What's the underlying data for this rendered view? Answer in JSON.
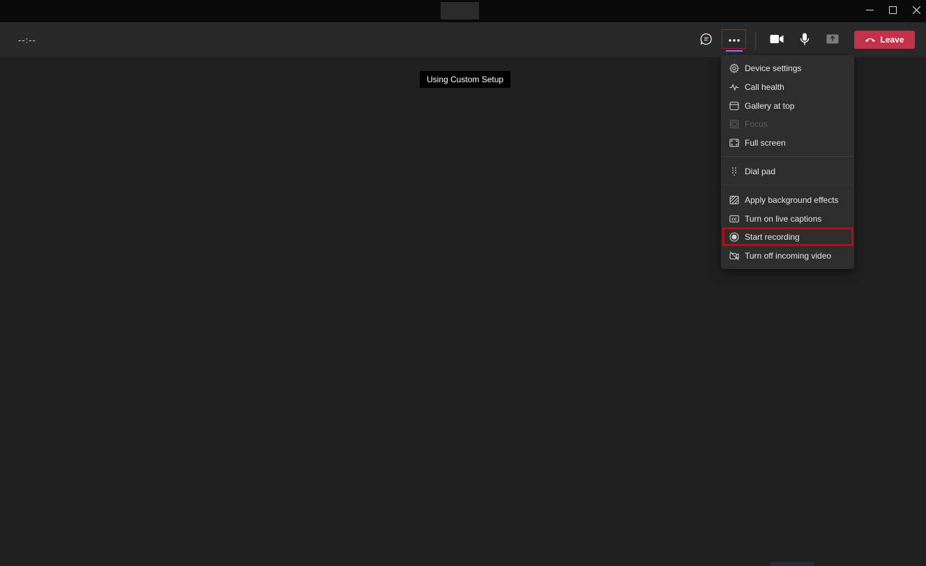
{
  "titlebar": {
    "controls": {
      "minimize_icon": "minimize-icon",
      "maximize_icon": "maximize-icon",
      "close_icon": "close-icon"
    }
  },
  "callbar": {
    "timer": "--:--",
    "buttons": {
      "chat_icon": "chat-icon",
      "more_icon": "more-options-icon",
      "camera_icon": "camera-icon",
      "mic_icon": "microphone-icon",
      "share_icon": "share-screen-icon"
    },
    "leave_label": "Leave",
    "leave_color": "#c4314b",
    "accent_color": "#7f85f5"
  },
  "tooltip": "Using Custom Setup",
  "more_menu": {
    "items": [
      {
        "label": "Device settings",
        "icon": "gear-icon",
        "enabled": true
      },
      {
        "label": "Call health",
        "icon": "pulse-icon",
        "enabled": true
      },
      {
        "label": "Gallery at top",
        "icon": "gallery-icon",
        "enabled": true
      },
      {
        "label": "Focus",
        "icon": "focus-icon",
        "enabled": false
      },
      {
        "label": "Full screen",
        "icon": "fullscreen-icon",
        "enabled": true
      },
      {
        "label": "Dial pad",
        "icon": "dialpad-icon",
        "enabled": true
      },
      {
        "label": "Apply background effects",
        "icon": "background-effects-icon",
        "enabled": true
      },
      {
        "label": "Turn on live captions",
        "icon": "captions-icon",
        "enabled": true
      },
      {
        "label": "Start recording",
        "icon": "record-icon",
        "enabled": true,
        "highlighted": true
      },
      {
        "label": "Turn off incoming video",
        "icon": "video-off-icon",
        "enabled": true
      }
    ],
    "highlight_color": "#b0101c"
  }
}
